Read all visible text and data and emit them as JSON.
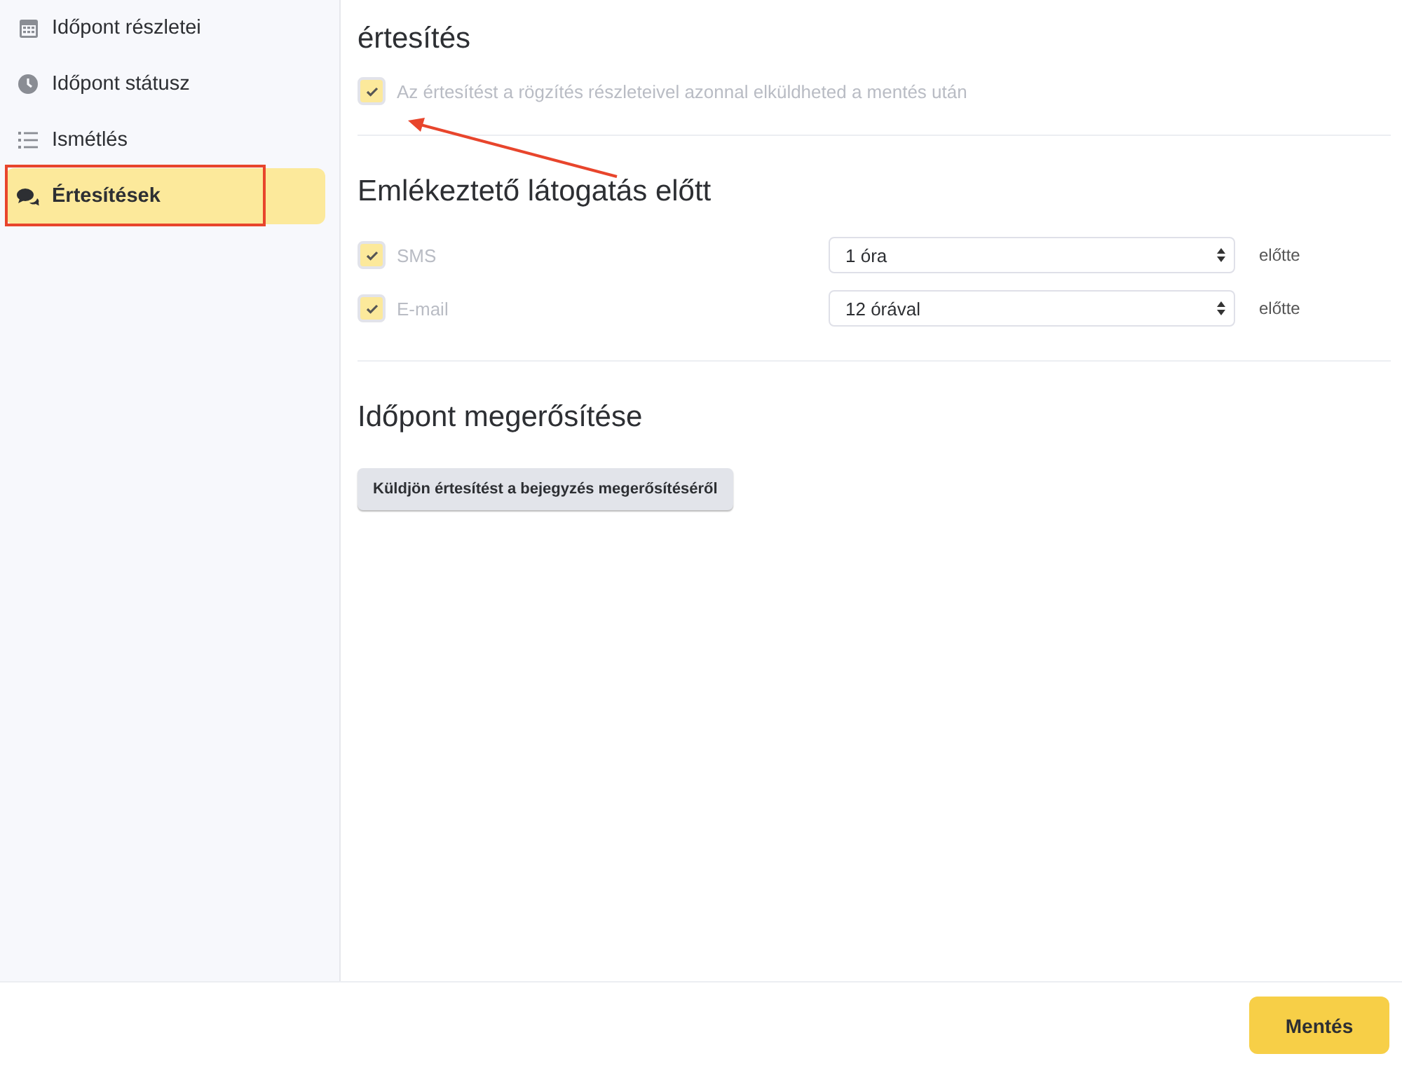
{
  "sidebar": {
    "items": [
      {
        "label": "Időpont részletei",
        "kind": "calendar",
        "selected": false
      },
      {
        "label": "Időpont státusz",
        "kind": "clock",
        "selected": false
      },
      {
        "label": "Ismétlés",
        "kind": "list",
        "selected": false
      },
      {
        "label": "Értesítések",
        "kind": "chat",
        "selected": true
      }
    ]
  },
  "notification": {
    "title": "értesítés",
    "option": {
      "label": "Az értesítést a rögzítés részleteivel azonnal elküldheted a mentés után",
      "checked": true,
      "disabled": true
    }
  },
  "reminder": {
    "title": "Emlékeztető látogatás előtt",
    "rows": [
      {
        "label": "SMS",
        "checked": true,
        "disabled": true,
        "value": "1 óra",
        "suffix": "előtte"
      },
      {
        "label": "E-mail",
        "checked": true,
        "disabled": true,
        "value": "12 órával",
        "suffix": "előtte"
      }
    ]
  },
  "confirmation": {
    "title": "Időpont megerősítése",
    "button": "Küldjön értesítést a bejegyzés megerősítéséről"
  },
  "footer": {
    "save_button": "Mentés"
  }
}
